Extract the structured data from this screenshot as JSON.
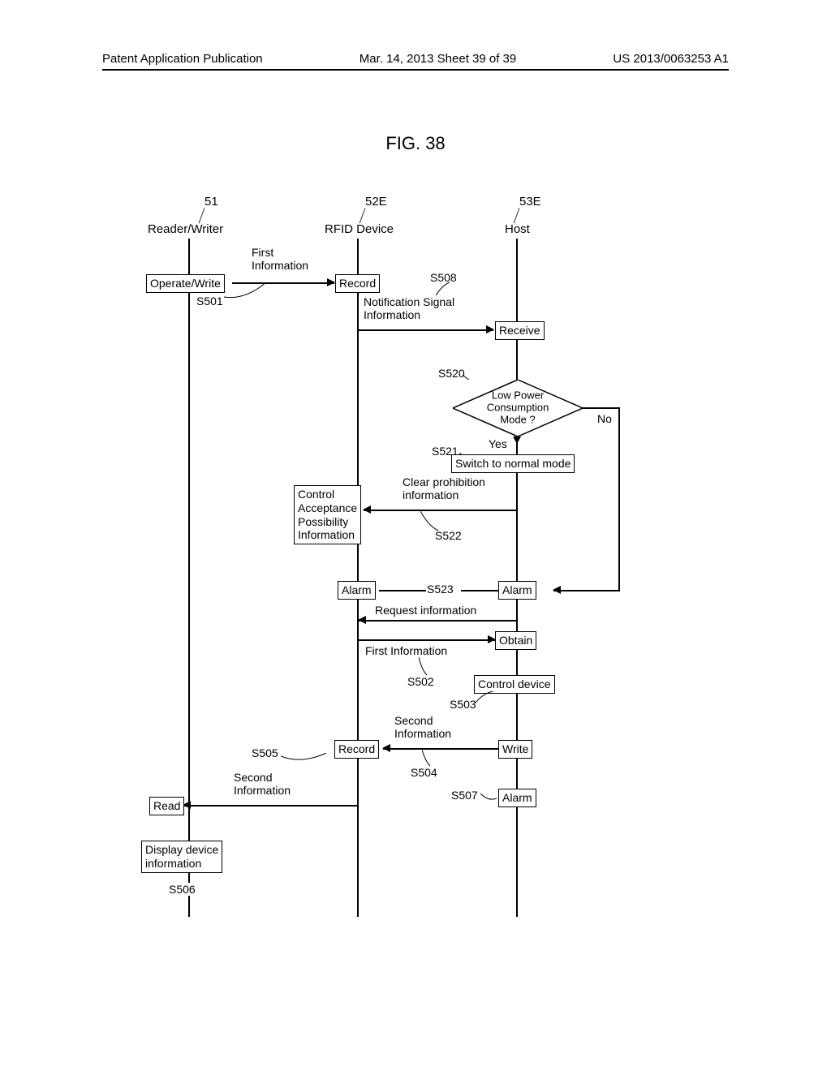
{
  "header": {
    "left": "Patent Application Publication",
    "center": "Mar. 14, 2013 Sheet 39 of 39",
    "right": "US 2013/0063253 A1"
  },
  "figure_title": "FIG. 38",
  "lanes": {
    "reader": {
      "num": "51",
      "label": "Reader/Writer"
    },
    "rfid": {
      "num": "52E",
      "label": "RFID Device"
    },
    "host": {
      "num": "53E",
      "label": "Host"
    }
  },
  "steps": {
    "s501": "S501",
    "s502": "S502",
    "s503": "S503",
    "s504": "S504",
    "s505": "S505",
    "s506": "S506",
    "s507": "S507",
    "s508": "S508",
    "s520": "S520",
    "s521": "S521",
    "s522": "S522",
    "s523": "S523"
  },
  "boxes": {
    "operate_write": "Operate/Write",
    "record1": "Record",
    "receive": "Receive",
    "switch_normal": "Switch to normal mode",
    "alarm_rfid": "Alarm",
    "alarm_host1": "Alarm",
    "obtain": "Obtain",
    "control_device": "Control device",
    "record2": "Record",
    "write": "Write",
    "alarm_host2": "Alarm",
    "read": "Read",
    "display": "Display device\ninformation"
  },
  "labels": {
    "first_info": "First\nInformation",
    "notif_signal": "Notification Signal\nInformation",
    "low_power": "Low Power\nConsumption\nMode ?",
    "yes": "Yes",
    "no": "No",
    "ctrl_accept": "Control\nAcceptance\nPossibility\nInformation",
    "clear_prohib": "Clear prohibition\ninformation",
    "request_info": "Request information",
    "first_info2": "First Information",
    "second_info": "Second\nInformation",
    "second_info2": "Second\nInformation"
  }
}
